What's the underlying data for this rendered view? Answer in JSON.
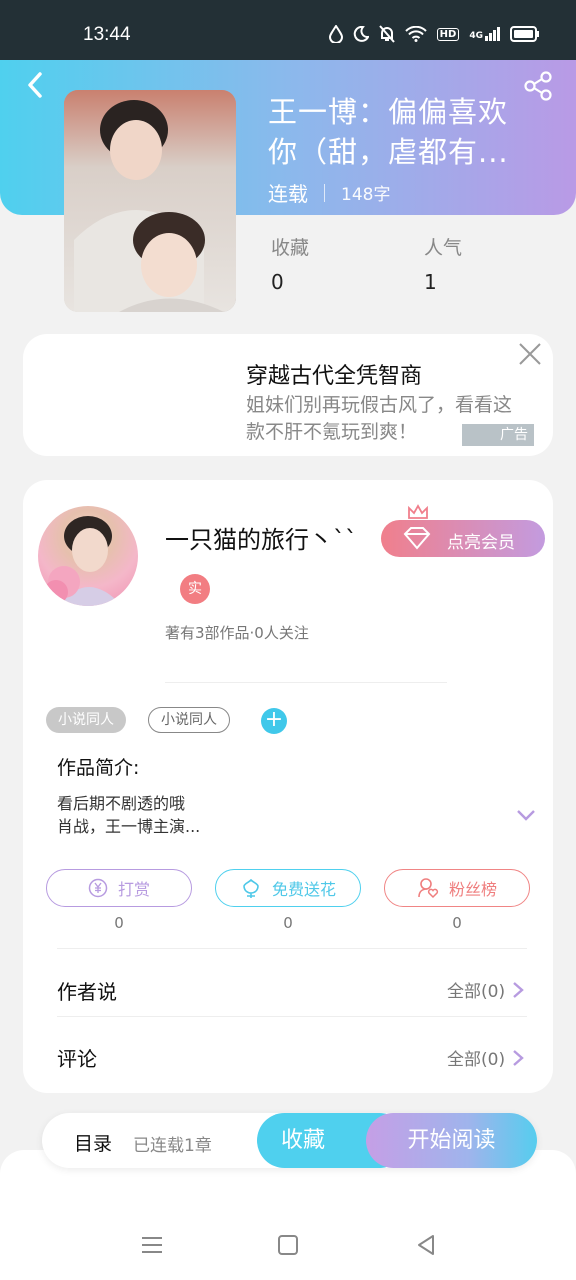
{
  "status": {
    "time": "13:44",
    "network": "4G",
    "hd_label": "HD"
  },
  "book": {
    "title_line1": "王一博：偏偏喜欢",
    "title_line2": "你（甜，虐都有...",
    "status": "连载",
    "words": "148字",
    "stats": [
      {
        "label": "收藏",
        "value": "0"
      },
      {
        "label": "人气",
        "value": "1"
      }
    ]
  },
  "ad": {
    "title": "穿越古代全凭智商",
    "desc": "姐妹们别再玩假古风了，看看这款不肝不氪玩到爽！",
    "badge": "广告"
  },
  "author": {
    "name": "一只猫的旅行丶``",
    "badge": "实",
    "info": "著有3部作品·0人关注",
    "vip_label": "点亮会员"
  },
  "tags": [
    "小说同人",
    "小说同人"
  ],
  "tag_add": "+",
  "intro": {
    "label": "作品简介:",
    "text": "看后期不剧透的哦\n肖战，王一博主演..."
  },
  "actions": [
    {
      "label": "打赏",
      "count": "0",
      "icon": "yuan-icon"
    },
    {
      "label": "免费送花",
      "count": "0",
      "icon": "flower-icon"
    },
    {
      "label": "粉丝榜",
      "count": "0",
      "icon": "fans-icon"
    }
  ],
  "rows": [
    {
      "label": "作者说",
      "right": "全部(0)"
    },
    {
      "label": "评论",
      "right": "全部(0)"
    }
  ],
  "bottom": {
    "toc_label": "目录",
    "toc_count": "已连载1章",
    "fav_label": "收藏",
    "read_label": "开始阅读"
  },
  "colors": {
    "accent_blue": "#4fd0ee",
    "accent_purple": "#b99ae6",
    "accent_red": "#f08585"
  }
}
